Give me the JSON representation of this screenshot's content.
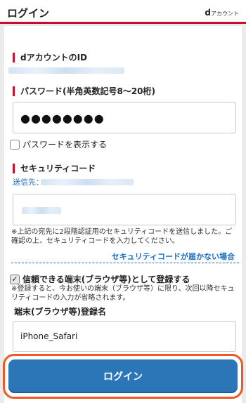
{
  "header": {
    "title": "ログイン",
    "brand_d": "d",
    "brand_text": "アカウント"
  },
  "form": {
    "id_label": "dアカウントのID",
    "password_label": "パスワード(半角英数記号8〜20桁)",
    "password_value": "●●●●●●●●",
    "show_password_label": "パスワードを表示する",
    "security_code_label": "セキュリティコード",
    "destination_label": "送信先：",
    "security_note": "※上記の宛先に2段階認証用のセキュリティコードを送信しました。ご確認の上、セキュリティコードを入力してください。",
    "security_link": "セキュリティコードが届かない場合",
    "register_device_label": "信頼できる端末(ブラウザ等)として登録する",
    "register_note": "※登録すると、今お使いの端末（ブラウザ等）に限り、次回以降セキュリティコードの入力が省略されます。",
    "device_name_label": "端末(ブラウザ等)登録名",
    "device_name_value": "iPhone_Safari",
    "login_button": "ログイン",
    "register_checked_mark": "✓"
  }
}
